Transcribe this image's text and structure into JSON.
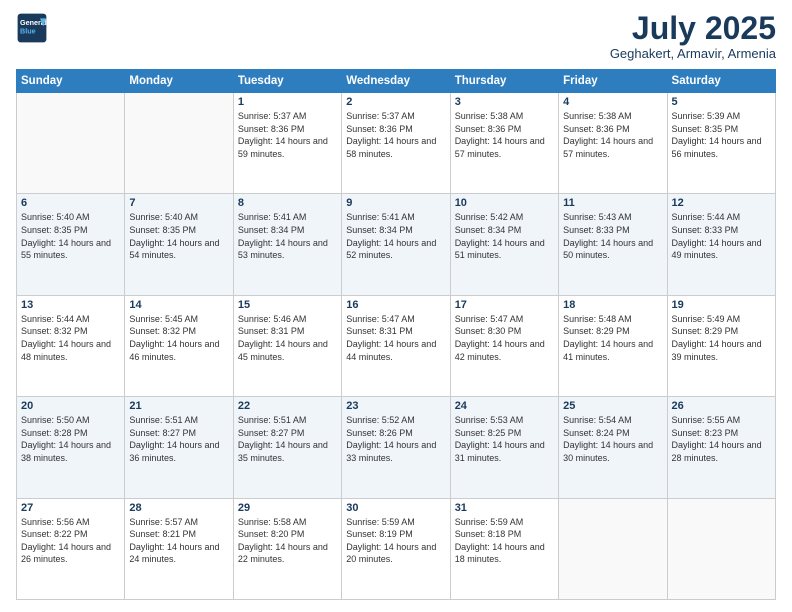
{
  "header": {
    "logo_line1": "General",
    "logo_line2": "Blue",
    "month": "July 2025",
    "location": "Geghakert, Armavir, Armenia"
  },
  "days_of_week": [
    "Sunday",
    "Monday",
    "Tuesday",
    "Wednesday",
    "Thursday",
    "Friday",
    "Saturday"
  ],
  "weeks": [
    [
      {
        "day": "",
        "info": ""
      },
      {
        "day": "",
        "info": ""
      },
      {
        "day": "1",
        "info": "Sunrise: 5:37 AM\nSunset: 8:36 PM\nDaylight: 14 hours and 59 minutes."
      },
      {
        "day": "2",
        "info": "Sunrise: 5:37 AM\nSunset: 8:36 PM\nDaylight: 14 hours and 58 minutes."
      },
      {
        "day": "3",
        "info": "Sunrise: 5:38 AM\nSunset: 8:36 PM\nDaylight: 14 hours and 57 minutes."
      },
      {
        "day": "4",
        "info": "Sunrise: 5:38 AM\nSunset: 8:36 PM\nDaylight: 14 hours and 57 minutes."
      },
      {
        "day": "5",
        "info": "Sunrise: 5:39 AM\nSunset: 8:35 PM\nDaylight: 14 hours and 56 minutes."
      }
    ],
    [
      {
        "day": "6",
        "info": "Sunrise: 5:40 AM\nSunset: 8:35 PM\nDaylight: 14 hours and 55 minutes."
      },
      {
        "day": "7",
        "info": "Sunrise: 5:40 AM\nSunset: 8:35 PM\nDaylight: 14 hours and 54 minutes."
      },
      {
        "day": "8",
        "info": "Sunrise: 5:41 AM\nSunset: 8:34 PM\nDaylight: 14 hours and 53 minutes."
      },
      {
        "day": "9",
        "info": "Sunrise: 5:41 AM\nSunset: 8:34 PM\nDaylight: 14 hours and 52 minutes."
      },
      {
        "day": "10",
        "info": "Sunrise: 5:42 AM\nSunset: 8:34 PM\nDaylight: 14 hours and 51 minutes."
      },
      {
        "day": "11",
        "info": "Sunrise: 5:43 AM\nSunset: 8:33 PM\nDaylight: 14 hours and 50 minutes."
      },
      {
        "day": "12",
        "info": "Sunrise: 5:44 AM\nSunset: 8:33 PM\nDaylight: 14 hours and 49 minutes."
      }
    ],
    [
      {
        "day": "13",
        "info": "Sunrise: 5:44 AM\nSunset: 8:32 PM\nDaylight: 14 hours and 48 minutes."
      },
      {
        "day": "14",
        "info": "Sunrise: 5:45 AM\nSunset: 8:32 PM\nDaylight: 14 hours and 46 minutes."
      },
      {
        "day": "15",
        "info": "Sunrise: 5:46 AM\nSunset: 8:31 PM\nDaylight: 14 hours and 45 minutes."
      },
      {
        "day": "16",
        "info": "Sunrise: 5:47 AM\nSunset: 8:31 PM\nDaylight: 14 hours and 44 minutes."
      },
      {
        "day": "17",
        "info": "Sunrise: 5:47 AM\nSunset: 8:30 PM\nDaylight: 14 hours and 42 minutes."
      },
      {
        "day": "18",
        "info": "Sunrise: 5:48 AM\nSunset: 8:29 PM\nDaylight: 14 hours and 41 minutes."
      },
      {
        "day": "19",
        "info": "Sunrise: 5:49 AM\nSunset: 8:29 PM\nDaylight: 14 hours and 39 minutes."
      }
    ],
    [
      {
        "day": "20",
        "info": "Sunrise: 5:50 AM\nSunset: 8:28 PM\nDaylight: 14 hours and 38 minutes."
      },
      {
        "day": "21",
        "info": "Sunrise: 5:51 AM\nSunset: 8:27 PM\nDaylight: 14 hours and 36 minutes."
      },
      {
        "day": "22",
        "info": "Sunrise: 5:51 AM\nSunset: 8:27 PM\nDaylight: 14 hours and 35 minutes."
      },
      {
        "day": "23",
        "info": "Sunrise: 5:52 AM\nSunset: 8:26 PM\nDaylight: 14 hours and 33 minutes."
      },
      {
        "day": "24",
        "info": "Sunrise: 5:53 AM\nSunset: 8:25 PM\nDaylight: 14 hours and 31 minutes."
      },
      {
        "day": "25",
        "info": "Sunrise: 5:54 AM\nSunset: 8:24 PM\nDaylight: 14 hours and 30 minutes."
      },
      {
        "day": "26",
        "info": "Sunrise: 5:55 AM\nSunset: 8:23 PM\nDaylight: 14 hours and 28 minutes."
      }
    ],
    [
      {
        "day": "27",
        "info": "Sunrise: 5:56 AM\nSunset: 8:22 PM\nDaylight: 14 hours and 26 minutes."
      },
      {
        "day": "28",
        "info": "Sunrise: 5:57 AM\nSunset: 8:21 PM\nDaylight: 14 hours and 24 minutes."
      },
      {
        "day": "29",
        "info": "Sunrise: 5:58 AM\nSunset: 8:20 PM\nDaylight: 14 hours and 22 minutes."
      },
      {
        "day": "30",
        "info": "Sunrise: 5:59 AM\nSunset: 8:19 PM\nDaylight: 14 hours and 20 minutes."
      },
      {
        "day": "31",
        "info": "Sunrise: 5:59 AM\nSunset: 8:18 PM\nDaylight: 14 hours and 18 minutes."
      },
      {
        "day": "",
        "info": ""
      },
      {
        "day": "",
        "info": ""
      }
    ]
  ]
}
